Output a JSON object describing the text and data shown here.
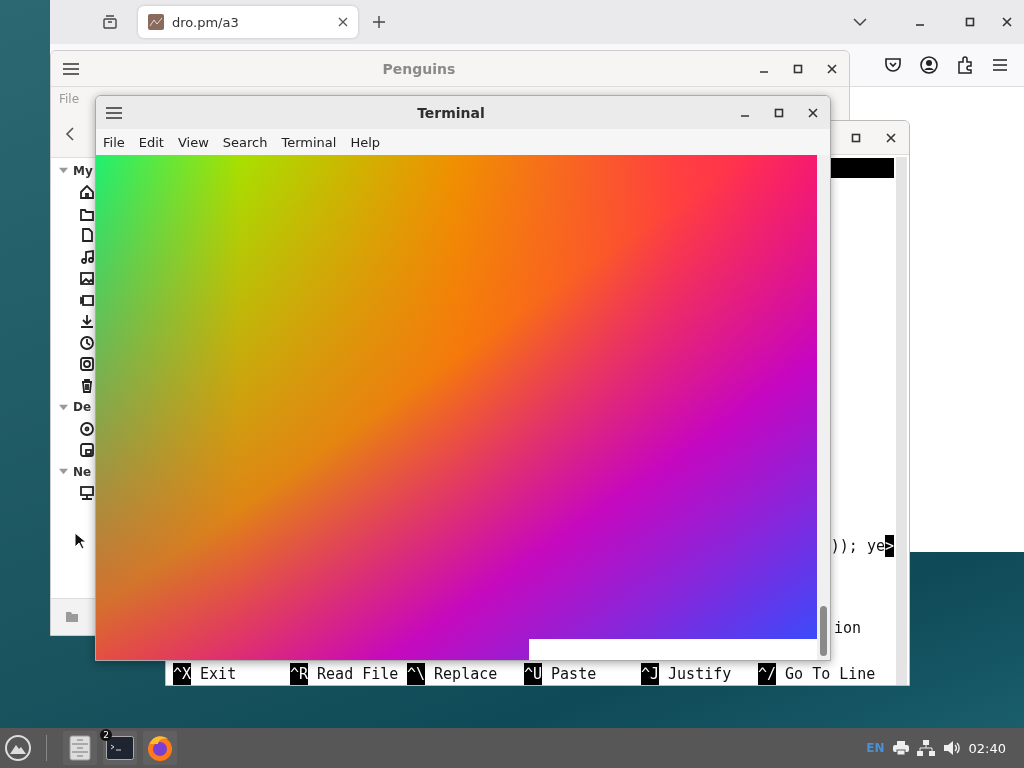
{
  "browser": {
    "tabs": [
      {
        "title": "dro.pm/a3",
        "selected": true
      }
    ]
  },
  "file_manager": {
    "title": "Penguins",
    "menu": [
      "File"
    ],
    "sidebar": [
      {
        "heading": "My",
        "expanded": true,
        "items": [
          {
            "kind": "home"
          },
          {
            "kind": "folder"
          },
          {
            "kind": "document"
          },
          {
            "kind": "music"
          },
          {
            "kind": "image"
          },
          {
            "kind": "video"
          },
          {
            "kind": "download"
          },
          {
            "kind": "clock"
          },
          {
            "kind": "camera"
          },
          {
            "kind": "trash"
          }
        ]
      },
      {
        "heading": "De",
        "expanded": true,
        "items": [
          {
            "kind": "disc"
          },
          {
            "kind": "drive"
          }
        ]
      },
      {
        "heading": "Ne",
        "expanded": true,
        "items": [
          {
            "kind": "computer"
          }
        ]
      }
    ]
  },
  "nano_window": {
    "lines": [
      {
        "text": ")); ye",
        "marker": ">"
      },
      {
        "text": "ion"
      }
    ],
    "shortcuts": [
      {
        "key": "^X",
        "label": "Exit"
      },
      {
        "key": "^R",
        "label": "Read File"
      },
      {
        "key": "^\\",
        "label": "Replace"
      },
      {
        "key": "^U",
        "label": "Paste"
      },
      {
        "key": "^J",
        "label": "Justify"
      },
      {
        "key": "^/",
        "label": "Go To Line"
      }
    ]
  },
  "terminal": {
    "title": "Terminal",
    "menu": [
      "File",
      "Edit",
      "View",
      "Search",
      "Terminal",
      "Help"
    ]
  },
  "taskbar": {
    "apps": [
      {
        "kind": "files"
      },
      {
        "kind": "terminal",
        "badge": "2"
      },
      {
        "kind": "firefox"
      }
    ],
    "language": "EN",
    "clock": "02:40"
  }
}
